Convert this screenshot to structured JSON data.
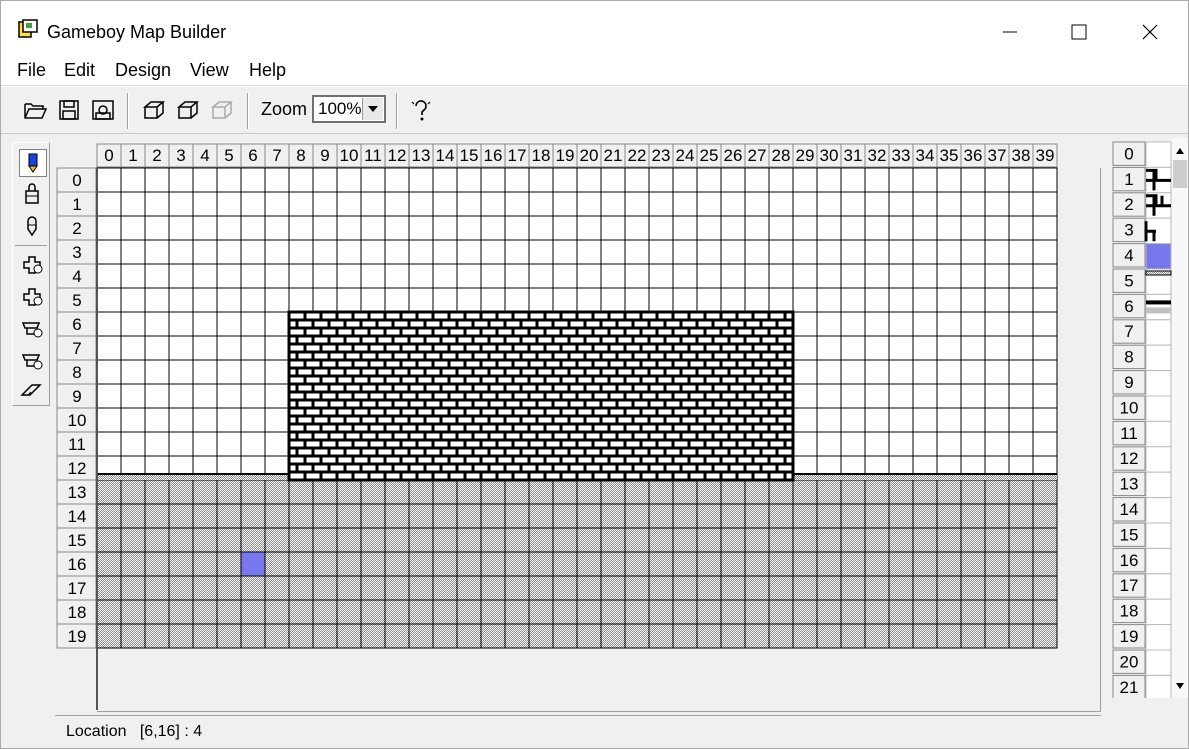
{
  "window": {
    "title": "Gameboy Map Builder",
    "controls": [
      "minimize-icon",
      "maximize-icon",
      "close-icon"
    ]
  },
  "menu": {
    "items": [
      "File",
      "Edit",
      "Design",
      "View",
      "Help"
    ]
  },
  "toolbar": {
    "buttons": [
      "open-icon",
      "save-icon",
      "save-as-icon",
      "add-row-icon",
      "add-column-icon",
      "remove-icon",
      "help-icon"
    ],
    "zoom_label": "Zoom",
    "zoom_value": "100%"
  },
  "tools": [
    "pencil-icon",
    "bucket-fill-icon",
    "dropper-icon",
    "insert-row-icon",
    "insert-column-icon",
    "delete-row-icon",
    "delete-column-icon",
    "clear-icon"
  ],
  "map": {
    "columns": [
      "0",
      "1",
      "2",
      "3",
      "4",
      "5",
      "6",
      "7",
      "8",
      "9",
      "10",
      "11",
      "12",
      "13",
      "14",
      "15",
      "16",
      "17",
      "18",
      "19",
      "20",
      "21",
      "22",
      "23",
      "24",
      "25",
      "26",
      "27",
      "28",
      "29",
      "30",
      "31",
      "32",
      "33",
      "34",
      "35",
      "36",
      "37",
      "38",
      "39"
    ],
    "rows": [
      "0",
      "1",
      "2",
      "3",
      "4",
      "5",
      "6",
      "7",
      "8",
      "9",
      "10",
      "11",
      "12",
      "13",
      "14",
      "15",
      "16",
      "17",
      "18",
      "19"
    ],
    "brick_region": {
      "col_start": 8,
      "col_end": 28,
      "row_start": 6,
      "row_end": 12
    },
    "ground_row": 12,
    "fill_rows_start": 13,
    "highlight_cell": {
      "col": 6,
      "row": 16
    },
    "colors": {
      "highlight": "#7777ee",
      "ground": "#d0d0d0",
      "brick": "#000000"
    }
  },
  "tile_panel": {
    "rows": [
      "0",
      "1",
      "2",
      "3",
      "4",
      "5",
      "6",
      "7",
      "8",
      "9",
      "10",
      "11",
      "12",
      "13",
      "14",
      "15",
      "16",
      "17",
      "18",
      "19",
      "20",
      "21"
    ],
    "selected_index": 4
  },
  "status": {
    "location_label": "Location",
    "location_value": "[6,16] : 4"
  }
}
